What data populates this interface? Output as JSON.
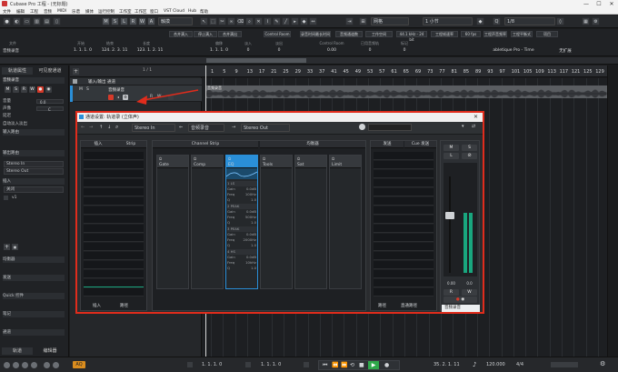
{
  "window": {
    "title": "Cubase Pro 工程 - (无标题)",
    "minimize": "—",
    "maximize": "☐",
    "close": "✕"
  },
  "menu": [
    "文件",
    "编辑",
    "工程",
    "音频",
    "MIDI",
    "乐谱",
    "媒体",
    "运行控制",
    "工作室",
    "工作区",
    "窗口",
    "VST Cloud",
    "Hub",
    "帮助"
  ],
  "toolbar": {
    "mode_buttons": [
      "M",
      "S",
      "L",
      "R",
      "W",
      "A"
    ],
    "automation_mode": "触摸",
    "snap_type": "网格",
    "grid_size": "1 小节",
    "quantize": "1/8"
  },
  "infobar": {
    "labels": [
      "文件",
      "开始",
      "结束",
      "长度",
      "偏移",
      "淡入",
      "淡出",
      "Control Room",
      "已用音频轨",
      "标记"
    ],
    "buttons": [
      "合并满入",
      "停止满入",
      "合并满出",
      "Control Room",
      "录音时间最长时间",
      "音频通道数",
      "工作空间",
      "44.1 kHz - 24 bit",
      "工程帧速率",
      "60 fps",
      "工程声音频率",
      "工程平衡式",
      "项目"
    ],
    "name": "音频录音",
    "start": "1. 1. 1.  0",
    "end": "124. 2. 3. 11",
    "length": "123. 1. 2. 11",
    "offset": "1. 1. 1.  0",
    "fade_in": "0",
    "fade_out": "0",
    "volume": "0.00",
    "ch_count": "0",
    "pos": "0",
    "preset": "abletique Pro - Time",
    "author": "无扩展"
  },
  "inspector": {
    "tabs": [
      "轨道属性",
      "可见度通道"
    ],
    "track_name": "音频录音",
    "row_labels": [
      "音量",
      "声像",
      "延迟",
      "输入路由",
      "输出路由",
      "插入",
      "均衡器",
      "发送",
      "Quick 控件",
      "笔记",
      "通道"
    ],
    "volume_value": "0.0",
    "pan_value": "C",
    "auto_fade": "自动淡入淡出",
    "input": "Stereo In",
    "output": "Stereo Out",
    "mode": "关闭",
    "lanes": "v1",
    "bottom_tabs": [
      "轨道",
      "编辑器"
    ]
  },
  "tracks": {
    "counter": "1 / 1",
    "folder": "输入/输出 通道",
    "track": "音频录音",
    "m": "M",
    "s": "S",
    "r": "R",
    "w": "W"
  },
  "ruler": [
    "1",
    "5",
    "9",
    "13",
    "17",
    "21",
    "25",
    "29",
    "33",
    "37",
    "41",
    "45",
    "49",
    "53",
    "57",
    "61",
    "65",
    "69",
    "73",
    "77",
    "81",
    "85",
    "89",
    "93",
    "97",
    "101",
    "105",
    "109",
    "113",
    "117",
    "121",
    "125",
    "129"
  ],
  "clip_name": "音频录音",
  "transport": {
    "left_locator": "1. 1. 1.  0",
    "right_locator": "1. 1. 1.  0",
    "position": "35. 2. 1. 11",
    "tempo": "120.000",
    "signature": "4/4"
  },
  "dialog": {
    "title": "通道设置: 轨道录 (立体声)",
    "input": "Stereo In",
    "output": "Stereo Out",
    "search_placeholder": "",
    "sections": {
      "inserts": "插入",
      "strip": "Strip",
      "channel_strip": "Channel Strip",
      "eq": "均衡器",
      "sends": "发送",
      "cue": "Cue 发送"
    },
    "strip_modules": [
      "Gate",
      "Comp",
      "EQ",
      "Tools",
      "Sat",
      "Limit"
    ],
    "eq_bands": [
      {
        "name": "1 LS",
        "gain": "0.0dB",
        "freq": "100Hz",
        "q": "1.0"
      },
      {
        "name": "2 PEAK",
        "gain": "0.0dB",
        "freq": "500Hz",
        "q": "1.0"
      },
      {
        "name": "3 PEAK",
        "gain": "0.0dB",
        "freq": "2000Hz",
        "q": "1.0"
      },
      {
        "name": "4 HS",
        "gain": "0.0dB",
        "freq": "10kHz",
        "q": "1.0"
      }
    ],
    "eq_row_labels": [
      "Gain",
      "Freq",
      "Q"
    ],
    "bottom_tabs_left": [
      "插入",
      "路径"
    ],
    "bottom_tabs_sends": [
      "路径",
      "直通路径"
    ],
    "fader": {
      "m": "M",
      "s": "S",
      "l": "L",
      "r": "R",
      "w": "W",
      "value_left": "0.00",
      "value_right": "0.0",
      "name": "音频录音"
    },
    "meter_level_left": 0.62,
    "meter_level_right": 0.62,
    "colors": {
      "border": "#e02c1c",
      "meter": "#19a67e",
      "accent": "#2a8fd8",
      "record": "#d63a2a"
    }
  }
}
